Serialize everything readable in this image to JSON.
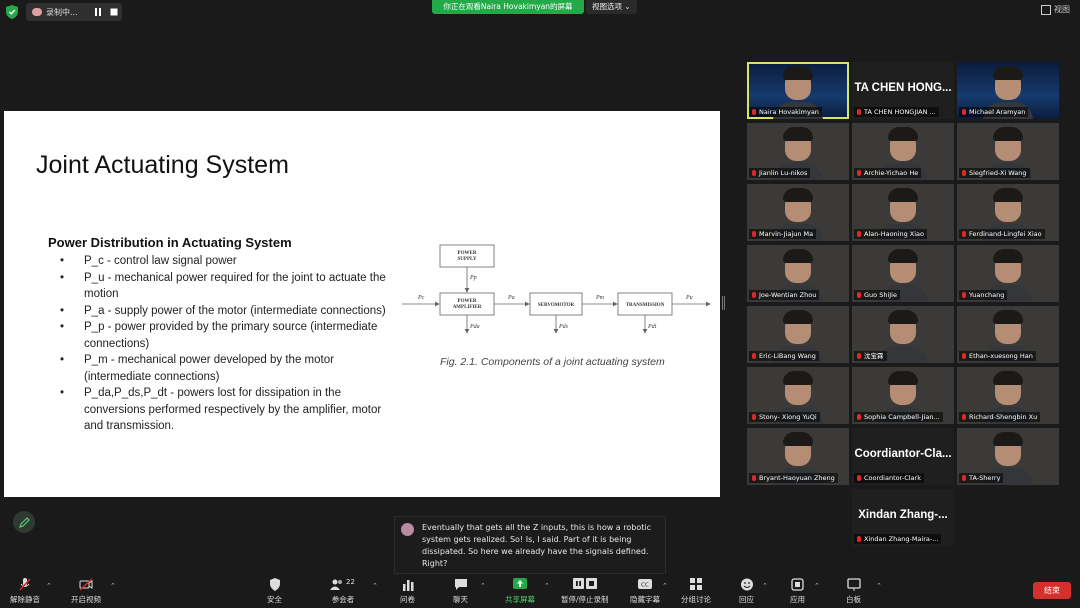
{
  "top": {
    "recording_label": "录制中...",
    "viewing_banner": "你正在观看Naira Hovakimyan的屏幕",
    "view_options": "视图选项",
    "view_button": "视图",
    "colors": {
      "banner": "#23a947",
      "end": "#d5312c"
    }
  },
  "slide": {
    "title": "Joint Actuating System",
    "heading": "Power Distribution in Actuating System",
    "bullets": [
      "P_c - control law signal power",
      "P_u - mechanical power required for the joint to actuate the motion",
      "P_a - supply power of the motor (intermediate connections)",
      "P_p - power provided by the primary source (intermediate connections)",
      "P_m - mechanical power developed by the motor (intermediate connections)",
      "P_da,P_ds,P_dt - powers lost for dissipation in the conversions performed respectively by the amplifier, motor and transmission."
    ],
    "diagram": {
      "power_supply": "POWER SUPPLY",
      "power_amplifier": "POWER AMPLIFIER",
      "servomotor": "SERVOMOTOR",
      "transmission": "TRANSMISSION",
      "pc": "Pc",
      "pp": "Pp",
      "pa": "Pa",
      "pm": "Pm",
      "pu": "Pu",
      "pda": "Pda",
      "pds": "Pds",
      "pdt": "Pdt"
    },
    "caption": "Fig. 2.1. Components of a joint actuating system"
  },
  "participants": [
    {
      "name": "Naira Hovakimyan",
      "kind": "space"
    },
    {
      "name": "TA CHEN HONGJIAN ...",
      "kind": "text",
      "big": "TA CHEN HONG..."
    },
    {
      "name": "Michael Aramyan",
      "kind": "space"
    },
    {
      "name": "Jianlin Lu-nikos",
      "kind": "photo"
    },
    {
      "name": "Archie-Yichao He",
      "kind": "photo"
    },
    {
      "name": "Siegfried-Xi Wang",
      "kind": "photo"
    },
    {
      "name": "Marvin-Jiajun Ma",
      "kind": "photo"
    },
    {
      "name": "Alan-Haoning Xiao",
      "kind": "photo"
    },
    {
      "name": "Ferdinand-Lingfei Xiao",
      "kind": "photo"
    },
    {
      "name": "Joe-Wentian Zhou",
      "kind": "photo"
    },
    {
      "name": "Guo ShiJie",
      "kind": "photo"
    },
    {
      "name": "Yuanchang",
      "kind": "photo"
    },
    {
      "name": "Eric-LiBang Wang",
      "kind": "photo"
    },
    {
      "name": "沈宝霖",
      "kind": "photo"
    },
    {
      "name": "Ethan-xuesong Han",
      "kind": "photo"
    },
    {
      "name": "Stony- Xiong YuQi",
      "kind": "photo"
    },
    {
      "name": "Sophia Campbell-Jian...",
      "kind": "photo"
    },
    {
      "name": "Richard-Shengbin Xu",
      "kind": "photo"
    },
    {
      "name": "Bryant-Haoyuan Zheng",
      "kind": "photo"
    },
    {
      "name": "Coordiantor-Clark",
      "kind": "text",
      "big": "Coordiantor-Cla..."
    },
    {
      "name": "TA-Sherry",
      "kind": "photo"
    },
    {
      "name": "Xindan Zhang-Maira-...",
      "kind": "text",
      "big": "Xindan  Zhang-..."
    }
  ],
  "chat": {
    "message": "Eventually that gets all the Z inputs, this is how a robotic system gets realized. So! Is, I said. Part of it is being dissipated. So here we already have the signals defined. Right?"
  },
  "toolbar": {
    "unmute": "解除静音",
    "start_video": "开启视频",
    "security": "安全",
    "participants": "参会者",
    "participants_count": "22",
    "polls": "问卷",
    "chat": "聊天",
    "share": "共享屏幕",
    "record": "暂停/停止录制",
    "captions": "隐藏字幕",
    "breakout": "分组讨论",
    "reactions": "回应",
    "apps": "应用",
    "whiteboard": "白板",
    "end": "结束"
  }
}
